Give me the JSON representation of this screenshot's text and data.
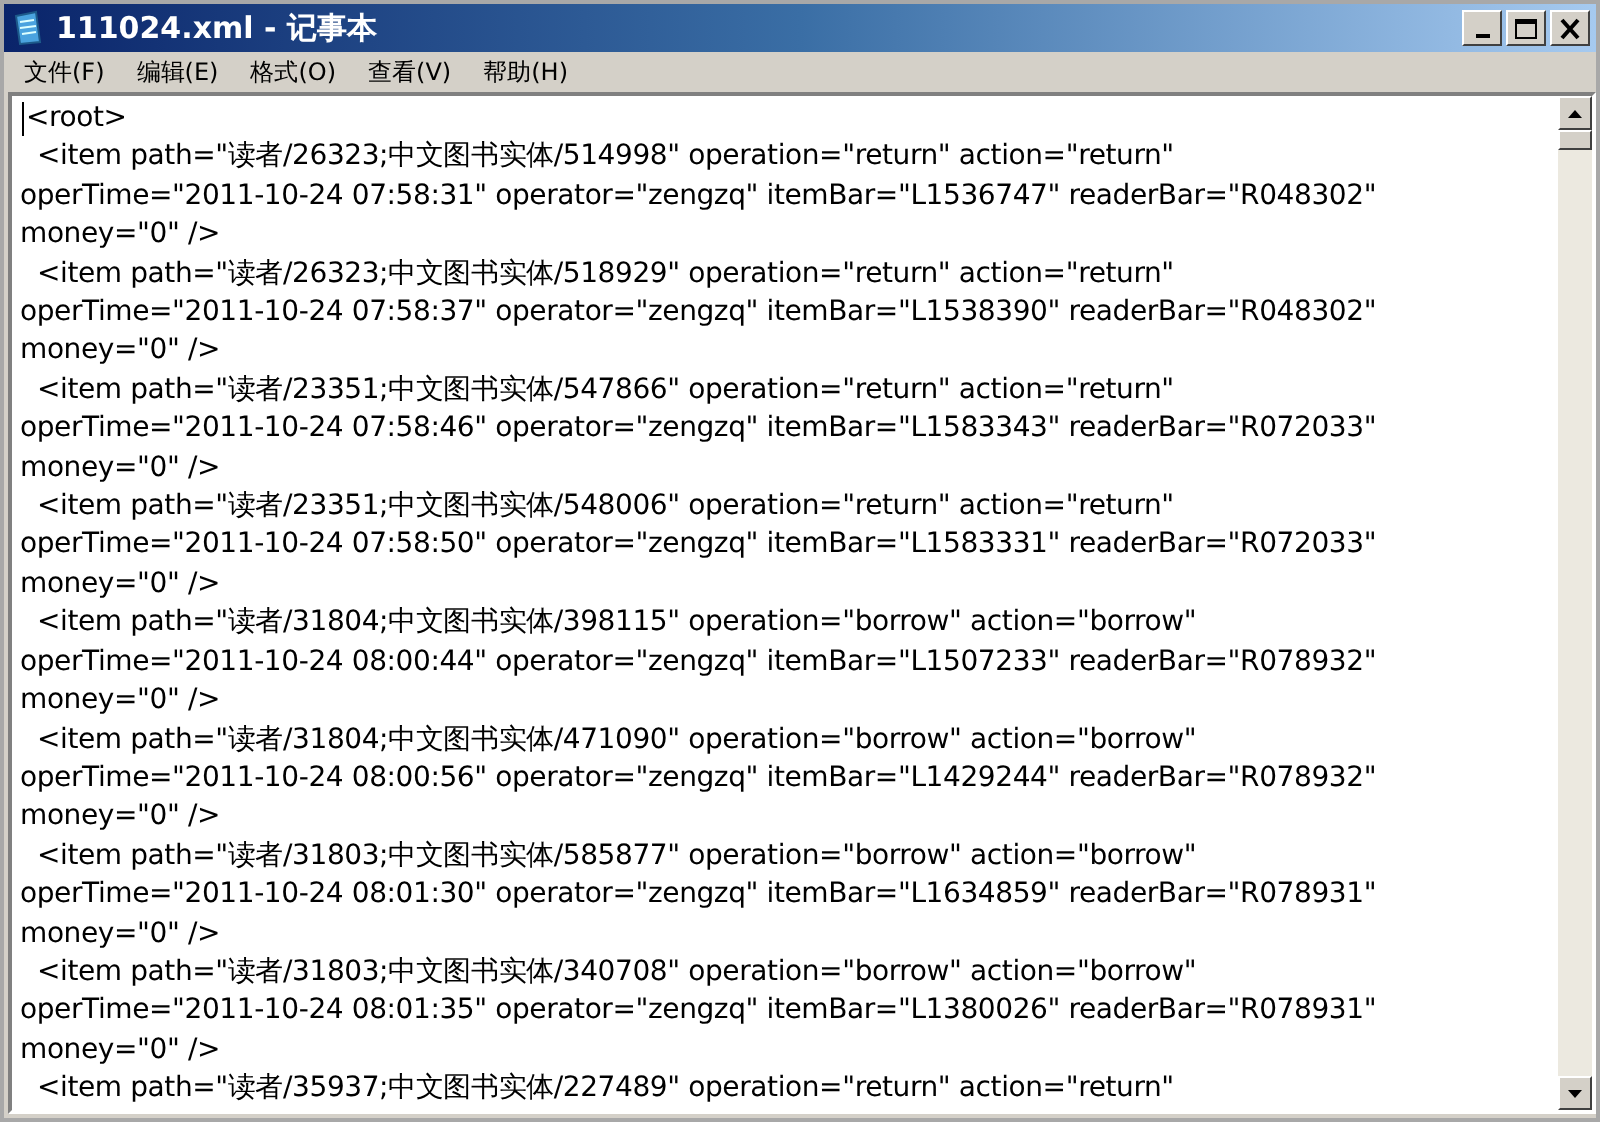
{
  "window": {
    "title": "111024.xml - 记事本"
  },
  "menu": [
    "文件(F)",
    "编辑(E)",
    "格式(O)",
    "查看(V)",
    "帮助(H)"
  ],
  "lines": [
    "<root>",
    "  <item path=\"读者/26323;中文图书实体/514998\" operation=\"return\" action=\"return\"",
    "operTime=\"2011-10-24 07:58:31\" operator=\"zengzq\" itemBar=\"L1536747\" readerBar=\"R048302\"",
    "money=\"0\" />",
    "  <item path=\"读者/26323;中文图书实体/518929\" operation=\"return\" action=\"return\"",
    "operTime=\"2011-10-24 07:58:37\" operator=\"zengzq\" itemBar=\"L1538390\" readerBar=\"R048302\"",
    "money=\"0\" />",
    "  <item path=\"读者/23351;中文图书实体/547866\" operation=\"return\" action=\"return\"",
    "operTime=\"2011-10-24 07:58:46\" operator=\"zengzq\" itemBar=\"L1583343\" readerBar=\"R072033\"",
    "money=\"0\" />",
    "  <item path=\"读者/23351;中文图书实体/548006\" operation=\"return\" action=\"return\"",
    "operTime=\"2011-10-24 07:58:50\" operator=\"zengzq\" itemBar=\"L1583331\" readerBar=\"R072033\"",
    "money=\"0\" />",
    "  <item path=\"读者/31804;中文图书实体/398115\" operation=\"borrow\" action=\"borrow\"",
    "operTime=\"2011-10-24 08:00:44\" operator=\"zengzq\" itemBar=\"L1507233\" readerBar=\"R078932\"",
    "money=\"0\" />",
    "  <item path=\"读者/31804;中文图书实体/471090\" operation=\"borrow\" action=\"borrow\"",
    "operTime=\"2011-10-24 08:00:56\" operator=\"zengzq\" itemBar=\"L1429244\" readerBar=\"R078932\"",
    "money=\"0\" />",
    "  <item path=\"读者/31803;中文图书实体/585877\" operation=\"borrow\" action=\"borrow\"",
    "operTime=\"2011-10-24 08:01:30\" operator=\"zengzq\" itemBar=\"L1634859\" readerBar=\"R078931\"",
    "money=\"0\" />",
    "  <item path=\"读者/31803;中文图书实体/340708\" operation=\"borrow\" action=\"borrow\"",
    "operTime=\"2011-10-24 08:01:35\" operator=\"zengzq\" itemBar=\"L1380026\" readerBar=\"R078931\"",
    "money=\"0\" />",
    "  <item path=\"读者/35937;中文图书实体/227489\" operation=\"return\" action=\"return\""
  ]
}
